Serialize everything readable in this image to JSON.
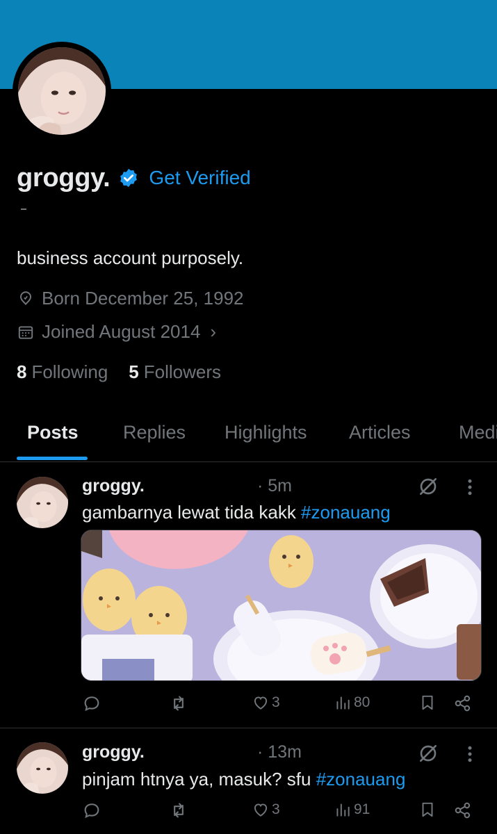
{
  "theme": {
    "banner_color": "#0a84b8",
    "accent": "#1d9bf0",
    "muted": "#71767b",
    "text": "#e7e9ea"
  },
  "profile": {
    "name": "groggy.",
    "get_verified": "Get Verified",
    "bio": "business account purposely.",
    "born": "Born December 25, 1992",
    "joined": "Joined August 2014",
    "following_count": "8",
    "following_label": "Following",
    "followers_count": "5",
    "followers_label": "Followers"
  },
  "tabs": [
    {
      "label": "Posts",
      "active": true
    },
    {
      "label": "Replies"
    },
    {
      "label": "Highlights"
    },
    {
      "label": "Articles"
    },
    {
      "label": "Media"
    }
  ],
  "posts": [
    {
      "author": "groggy.",
      "time": "· 5m",
      "text": "gambarnya lewat tida kakk ",
      "hashtag": "#zonauang",
      "likes": "3",
      "views": "80",
      "has_media": true
    },
    {
      "author": "groggy.",
      "time": "· 13m",
      "text": "pinjam htnya ya, masuk? sfu ",
      "hashtag": "#zonauang",
      "likes": "3",
      "views": "91",
      "has_media": false
    }
  ]
}
